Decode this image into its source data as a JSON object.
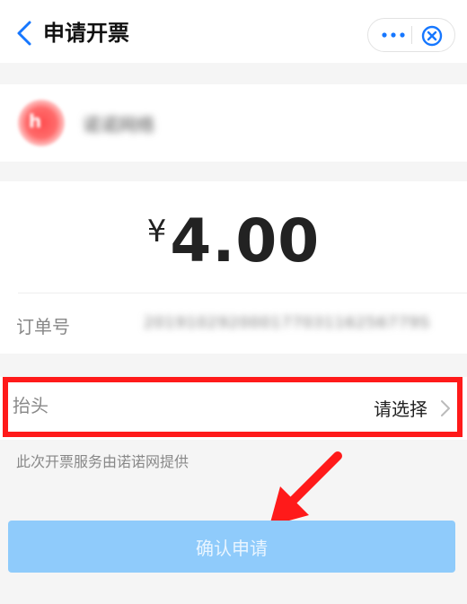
{
  "header": {
    "title": "申请开票",
    "more_icon": "ellipsis-icon",
    "close_icon": "target-close-icon"
  },
  "merchant": {
    "logo_text": "h",
    "name": "诺诺网络"
  },
  "invoice": {
    "currency": "¥",
    "amount": "4.00",
    "order_label": "订单号",
    "order_number": "20191029200017703116256779S"
  },
  "title_field": {
    "label": "抬头",
    "value": "请选择"
  },
  "provider_note": "此次开票服务由诺诺网提供",
  "confirm_label": "确认申请",
  "colors": {
    "accent": "#1677ff",
    "button_disabled": "#8fcbfb",
    "highlight": "#ff1a1a"
  }
}
